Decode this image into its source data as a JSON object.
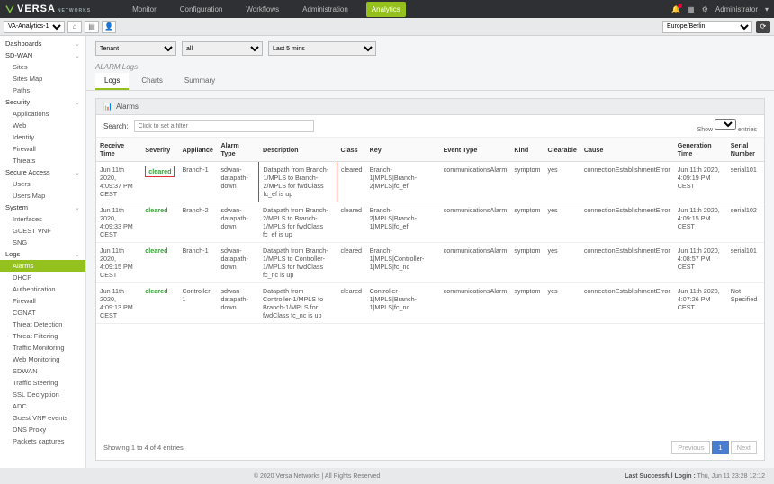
{
  "header": {
    "brand": "VERSA",
    "brand_sub": "NETWORKS",
    "nav": [
      "Monitor",
      "Configuration",
      "Workflows",
      "Administration",
      "Analytics"
    ],
    "nav_active": 4,
    "user_label": "Administrator"
  },
  "secondbar": {
    "tenant_select": "VA-Analytics-1",
    "timezone": "Europe/Berlin"
  },
  "sidebar": {
    "sections": [
      {
        "label": "Dashboards",
        "type": "section",
        "expand": true
      },
      {
        "label": "SD-WAN",
        "type": "section",
        "expand": true
      },
      {
        "label": "Sites",
        "type": "sub"
      },
      {
        "label": "Sites Map",
        "type": "sub"
      },
      {
        "label": "Paths",
        "type": "sub"
      },
      {
        "label": "Security",
        "type": "section",
        "expand": true
      },
      {
        "label": "Applications",
        "type": "sub"
      },
      {
        "label": "Web",
        "type": "sub"
      },
      {
        "label": "Identity",
        "type": "sub"
      },
      {
        "label": "Firewall",
        "type": "sub"
      },
      {
        "label": "Threats",
        "type": "sub"
      },
      {
        "label": "Secure Access",
        "type": "section",
        "expand": true
      },
      {
        "label": "Users",
        "type": "sub"
      },
      {
        "label": "Users Map",
        "type": "sub"
      },
      {
        "label": "System",
        "type": "section",
        "expand": true
      },
      {
        "label": "Interfaces",
        "type": "sub"
      },
      {
        "label": "GUEST VNF",
        "type": "sub"
      },
      {
        "label": "SNG",
        "type": "sub"
      },
      {
        "label": "Logs",
        "type": "section",
        "expand": true
      },
      {
        "label": "Alarms",
        "type": "sub",
        "active": true
      },
      {
        "label": "DHCP",
        "type": "sub"
      },
      {
        "label": "Authentication",
        "type": "sub"
      },
      {
        "label": "Firewall",
        "type": "sub"
      },
      {
        "label": "CGNAT",
        "type": "sub"
      },
      {
        "label": "Threat Detection",
        "type": "sub"
      },
      {
        "label": "Threat Filtering",
        "type": "sub"
      },
      {
        "label": "Traffic Monitoring",
        "type": "sub"
      },
      {
        "label": "Web Monitoring",
        "type": "sub"
      },
      {
        "label": "SDWAN",
        "type": "sub"
      },
      {
        "label": "Traffic Steering",
        "type": "sub"
      },
      {
        "label": "SSL Decryption",
        "type": "sub"
      },
      {
        "label": "ADC",
        "type": "sub"
      },
      {
        "label": "Guest VNF events",
        "type": "sub"
      },
      {
        "label": "DNS Proxy",
        "type": "sub"
      },
      {
        "label": "Packets captures",
        "type": "sub"
      }
    ]
  },
  "filters": {
    "f1": "Tenant",
    "f2": "all",
    "f3": "Last 5 mins"
  },
  "page": {
    "breadcrumb": "ALARM Logs",
    "tabs": [
      "Logs",
      "Charts",
      "Summary"
    ],
    "tab_active": 0,
    "panel_title": "Alarms",
    "search_label": "Search:",
    "search_placeholder": "Click to set a filter",
    "show_label": "Show",
    "entries_label": "entries",
    "columns": [
      "Receive Time",
      "Severity",
      "Appliance",
      "Alarm Type",
      "Description",
      "Class",
      "Key",
      "Event Type",
      "Kind",
      "Clearable",
      "Cause",
      "Generation Time",
      "Serial Number"
    ],
    "rows": [
      {
        "time": "Jun 11th 2020, 4:09:37 PM CEST",
        "sev": "cleared",
        "app": "Branch-1",
        "atype": "sdwan-datapath-down",
        "desc": "Datapath from Branch-1/MPLS to Branch-2/MPLS for fwdClass fc_ef is up",
        "class": "cleared",
        "key": "Branch-1|MPLS|Branch-2|MPLS|fc_ef",
        "etype": "communicationsAlarm",
        "kind": "symptom",
        "clr": "yes",
        "cause": "connectionEstablishmentError",
        "gen": "Jun 11th 2020, 4:09:19 PM CEST",
        "serial": "serial101",
        "hl": true
      },
      {
        "time": "Jun 11th 2020, 4:09:33 PM CEST",
        "sev": "cleared",
        "app": "Branch-2",
        "atype": "sdwan-datapath-down",
        "desc": "Datapath from Branch-2/MPLS to Branch-1/MPLS for fwdClass fc_ef is up",
        "class": "cleared",
        "key": "Branch-2|MPLS|Branch-1|MPLS|fc_ef",
        "etype": "communicationsAlarm",
        "kind": "symptom",
        "clr": "yes",
        "cause": "connectionEstablishmentError",
        "gen": "Jun 11th 2020, 4:09:15 PM CEST",
        "serial": "serial102"
      },
      {
        "time": "Jun 11th 2020, 4:09:15 PM CEST",
        "sev": "cleared",
        "app": "Branch-1",
        "atype": "sdwan-datapath-down",
        "desc": "Datapath from Branch-1/MPLS to Controller-1/MPLS for fwdClass fc_nc is up",
        "class": "cleared",
        "key": "Branch-1|MPLS|Controller-1|MPLS|fc_nc",
        "etype": "communicationsAlarm",
        "kind": "symptom",
        "clr": "yes",
        "cause": "connectionEstablishmentError",
        "gen": "Jun 11th 2020, 4:08:57 PM CEST",
        "serial": "serial101"
      },
      {
        "time": "Jun 11th 2020, 4:09:13 PM CEST",
        "sev": "cleared",
        "app": "Controller-1",
        "atype": "sdwan-datapath-down",
        "desc": "Datapath from Controller-1/MPLS to Branch-1/MPLS for fwdClass fc_nc is up",
        "class": "cleared",
        "key": "Controller-1|MPLS|Branch-1|MPLS|fc_nc",
        "etype": "communicationsAlarm",
        "kind": "symptom",
        "clr": "yes",
        "cause": "connectionEstablishmentError",
        "gen": "Jun 11th 2020, 4:07:26 PM CEST",
        "serial": "Not Specified"
      }
    ],
    "footer_info": "Showing 1 to 4 of 4 entries",
    "pager": {
      "prev": "Previous",
      "next": "Next",
      "page": "1"
    }
  },
  "bottom": {
    "copyright": "© 2020 Versa Networks | All Rights Reserved",
    "last_login_label": "Last Successful Login :",
    "last_login_value": "Thu, Jun 11 23:28 12:12"
  }
}
